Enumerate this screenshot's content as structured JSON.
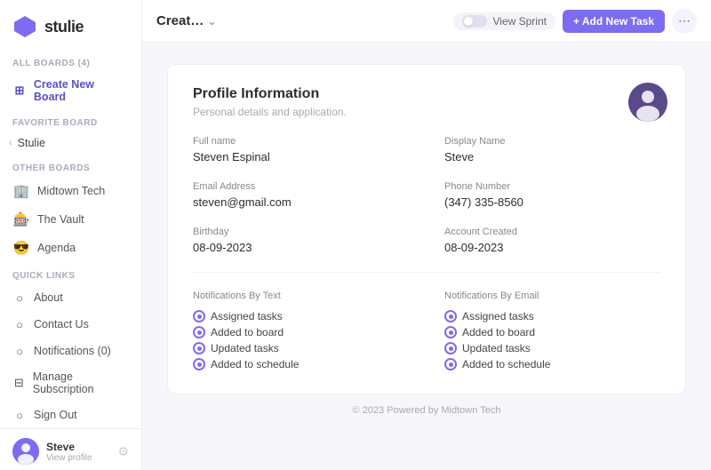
{
  "app": {
    "logo_text": "stulie"
  },
  "sidebar": {
    "all_boards_label": "ALL BOARDS (4)",
    "create_new_label": "Create New Board",
    "favorite_board_label": "Favorite Board",
    "favorite_board_name": "Stulie",
    "other_boards_label": "Other Boards",
    "boards": [
      {
        "name": "Midtown Tech",
        "emoji": "🏢"
      },
      {
        "name": "The Vault",
        "emoji": "🎰"
      },
      {
        "name": "Agenda",
        "emoji": "😎"
      }
    ],
    "quick_links_label": "Quick Links",
    "quick_links": [
      {
        "name": "About"
      },
      {
        "name": "Contact Us"
      },
      {
        "name": "Notifications (0)"
      },
      {
        "name": "Manage Subscription"
      },
      {
        "name": "Sign Out"
      }
    ],
    "footer": {
      "name": "Steve",
      "sub": "View profile"
    }
  },
  "topbar": {
    "title": "Creat…",
    "view_sprint": "View Sprint",
    "add_task": "+ Add New Task"
  },
  "profile": {
    "title": "Profile Information",
    "subtitle": "Personal details and application.",
    "fields": {
      "full_name_label": "Full name",
      "full_name_value": "Steven Espinal",
      "display_name_label": "Display Name",
      "display_name_value": "Steve",
      "email_label": "Email Address",
      "email_value": "steven@gmail.com",
      "phone_label": "Phone Number",
      "phone_value": "(347) 335-8560",
      "birthday_label": "Birthday",
      "birthday_value": "08-09-2023",
      "account_created_label": "Account Created",
      "account_created_value": "08-09-2023"
    },
    "notifications_text_label": "Notifications By Text",
    "notifications_email_label": "Notifications By Email",
    "notification_items": [
      "Assigned tasks",
      "Added to board",
      "Updated tasks",
      "Added to schedule"
    ]
  },
  "footer": {
    "text": "© 2023 Powered by Midtown Tech"
  }
}
